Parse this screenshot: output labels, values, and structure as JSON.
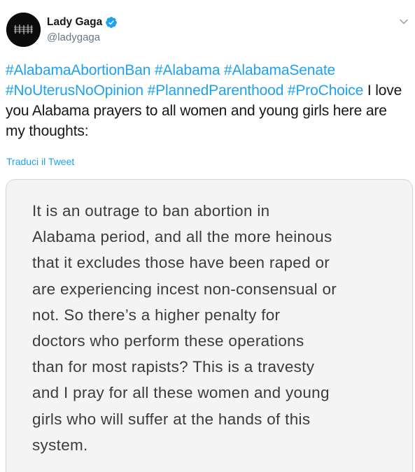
{
  "author": {
    "display_name": "Lady Gaga",
    "handle": "@ladygaga",
    "verified": true,
    "avatar_icon": "avatar-image"
  },
  "tweet": {
    "segments": [
      {
        "type": "hashtag",
        "text": "#AlabamaAbortionBan"
      },
      {
        "type": "text",
        "text": " "
      },
      {
        "type": "hashtag",
        "text": "#Alabama"
      },
      {
        "type": "text",
        "text": " "
      },
      {
        "type": "hashtag",
        "text": "#AlabamaSenate"
      },
      {
        "type": "text",
        "text": " "
      },
      {
        "type": "hashtag",
        "text": "#NoUterusNoOpinion"
      },
      {
        "type": "text",
        "text": " "
      },
      {
        "type": "hashtag",
        "text": "#PlannedParenthood"
      },
      {
        "type": "text",
        "text": " "
      },
      {
        "type": "hashtag",
        "text": "#ProChoice"
      },
      {
        "type": "text",
        "text": " I love you Alabama prayers to all women and young girls here are my thoughts:"
      }
    ],
    "translate_label": "Traduci il Tweet"
  },
  "media": {
    "note_lines": [
      "It is an outrage to ban abortion in",
      "Alabama period, and all the more heinous",
      "that it excludes those have been raped or",
      "are experiencing incest non-consensual or",
      "not. So there’s a higher penalty for",
      "doctors who perform these operations",
      "than for most rapists? This is a travesty",
      "and I pray for all these women and young",
      "girls who will suffer at the hands of this",
      "system."
    ]
  },
  "colors": {
    "link": "#1da1f2",
    "text": "#14171a",
    "muted": "#657786",
    "note_text": "#3c3c3c",
    "note_bg": "#f4f4f4"
  },
  "icons": {
    "verified": "verified-badge-icon",
    "caret": "chevron-down-icon"
  }
}
